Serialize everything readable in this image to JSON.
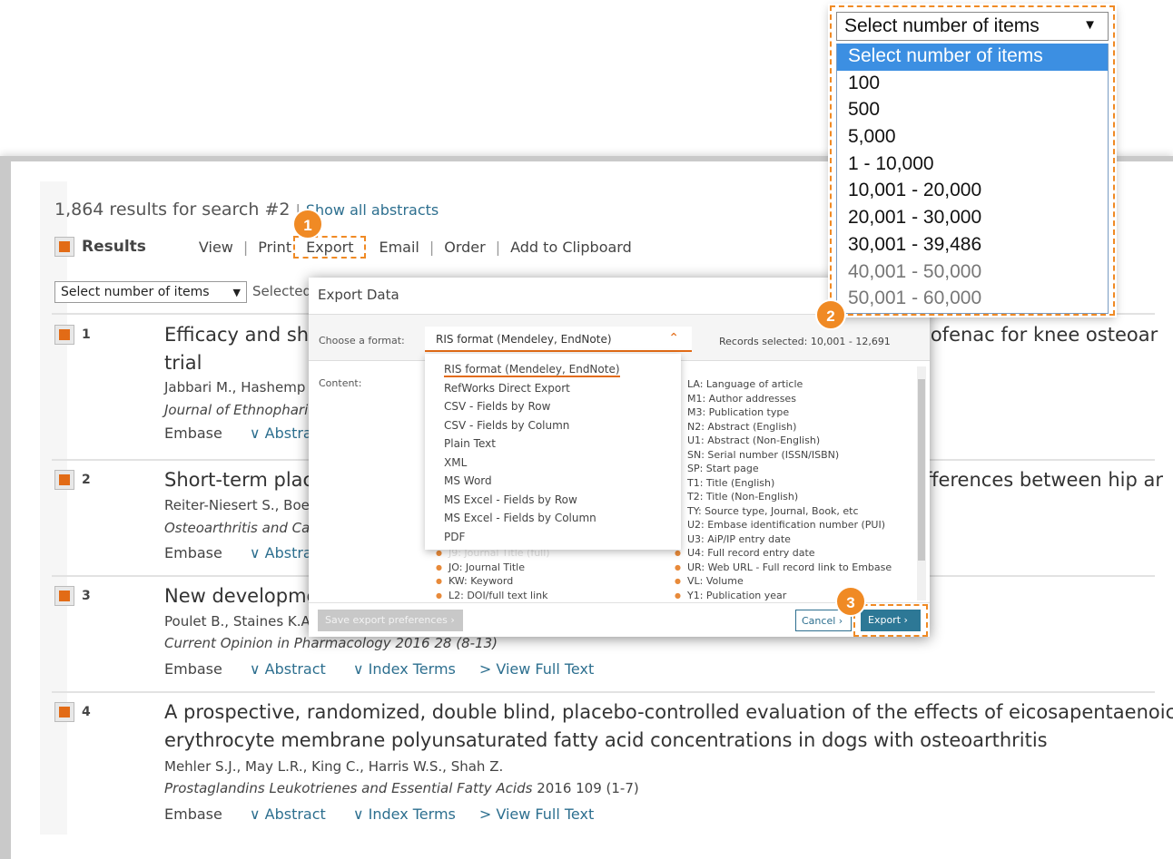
{
  "search_summary": {
    "count_text": "1,864 results for search #2",
    "show_all": "Show all abstracts"
  },
  "toolbar": {
    "results_label": "Results",
    "view": "View",
    "print": "Print",
    "export": "Export",
    "email": "Email",
    "order": "Order",
    "clipboard": "Add to Clipboard"
  },
  "select_items": {
    "value": "Select number of items",
    "selected_label": "Selected"
  },
  "results": [
    {
      "num": "1",
      "title": "Efficacy and sho",
      "title_right": "lofenac for knee osteoar",
      "title_line2": "trial",
      "authors": "Jabbari M., Hashemp",
      "journal": "Journal of Ethnophari",
      "source": "Embase",
      "abstract": "Abstra"
    },
    {
      "num": "2",
      "title": "Short-term plac",
      "title_right": "fferences between hip ar",
      "authors": "Reiter-Niesert S., Boe",
      "journal": "Osteoarthritis and Ca",
      "source": "Embase",
      "abstract": "Abstra"
    },
    {
      "num": "3",
      "title": "New developme",
      "authors": "Poulet B., Staines K.A",
      "journal": "Current Opinion in Pharmacology 2016 28 (8-13)",
      "source": "Embase",
      "abstract": "Abstract",
      "index": "Index Terms",
      "fulltext": "View Full Text"
    },
    {
      "num": "4",
      "title": "A prospective, randomized, double blind, placebo-controlled evaluation of the effects of eicosapentaenoic aci",
      "title_line2": "erythrocyte membrane polyunsaturated fatty acid concentrations in dogs with osteoarthritis",
      "authors": "Mehler S.J., May L.R., King C., Harris W.S., Shah Z.",
      "journal": "Prostaglandins Leukotrienes and Essential Fatty Acids",
      "journal_meta": " 2016 109 (1-7)",
      "source": "Embase",
      "abstract": "Abstract",
      "index": "Index Terms",
      "fulltext": "View Full Text"
    }
  ],
  "export_dialog": {
    "title": "Export Data",
    "format_label": "Choose a format:",
    "content_label": "Content:",
    "format_value": "RIS format (Mendeley, EndNote)",
    "records_selected": "Records selected: 10,001 - 12,691",
    "format_options": [
      "RIS format (Mendeley, EndNote)",
      "RefWorks Direct Export",
      "CSV - Fields by Row",
      "CSV - Fields by Column",
      "Plain Text",
      "XML",
      "MS Word",
      "MS Excel - Fields by Row",
      "MS Excel - Fields by Column",
      "PDF"
    ],
    "fields_left": [
      "J9: Journal Title (full)",
      "JO: Journal Title",
      "KW: Keyword",
      "L2: DOI/full text link"
    ],
    "fields_right": [
      "LA: Language of article",
      "M1: Author addresses",
      "M3: Publication type",
      "N2: Abstract (English)",
      "U1: Abstract (Non-English)",
      "SN: Serial number (ISSN/ISBN)",
      "SP: Start page",
      "T1: Title (English)",
      "T2: Title (Non-English)",
      "TY: Source type, Journal, Book, etc",
      "U2: Embase identification number (PUI)",
      "U3: AiP/IP entry date",
      "U4: Full record entry date",
      "UR: Web URL - Full record link to Embase",
      "VL: Volume",
      "Y1: Publication year"
    ],
    "save_prefs": "Save export preferences",
    "cancel": "Cancel",
    "export": "Export"
  },
  "big_dropdown": {
    "value": "Select number of items",
    "options": [
      "Select number of items",
      "100",
      "500",
      "5,000",
      "1 - 10,000",
      "10,001 - 20,000",
      "20,001 - 30,000",
      "30,001 - 39,486",
      "40,001 - 50,000",
      "50,001 - 60,000"
    ]
  },
  "badges": [
    "1",
    "2",
    "3"
  ],
  "colors": {
    "accent": "#f08a24",
    "link": "#2d6f8f",
    "highlight": "#3c8fe2",
    "button": "#2d7896"
  }
}
